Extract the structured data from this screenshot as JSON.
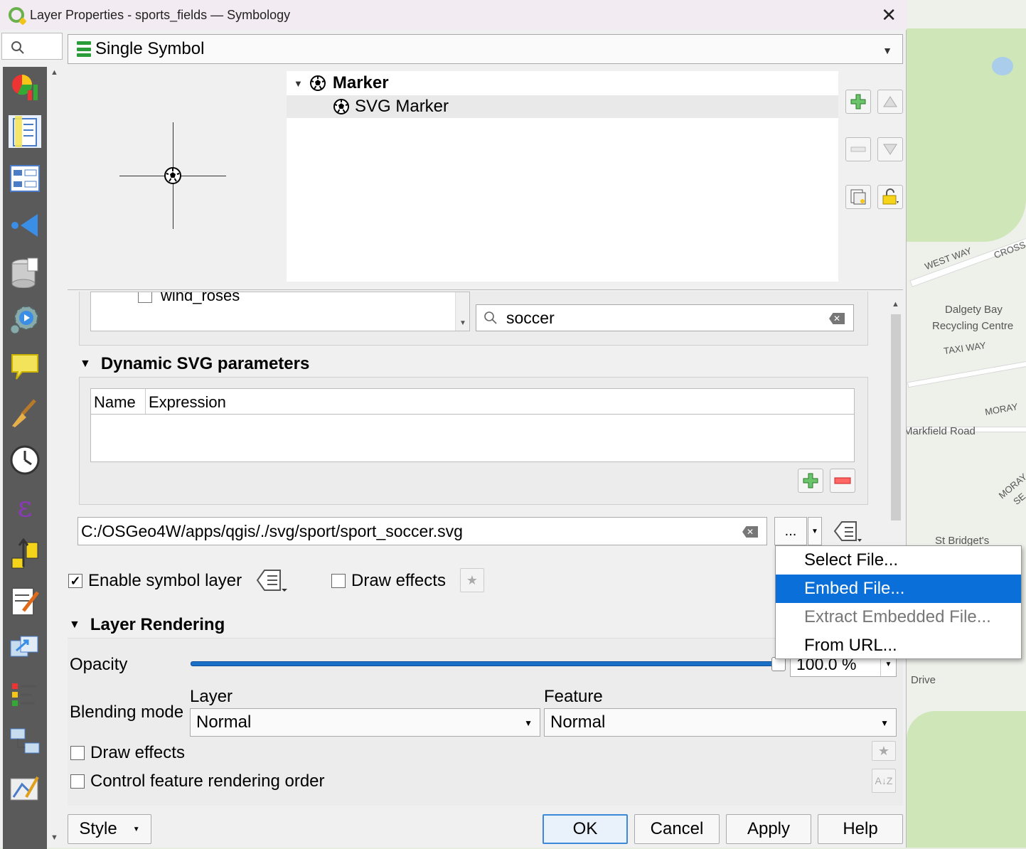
{
  "window": {
    "title": "Layer Properties - sports_fields — Symbology",
    "close_label": "✕"
  },
  "renderer": {
    "selected": "Single Symbol"
  },
  "symbol_tree": {
    "root": "Marker",
    "child": "SVG Marker"
  },
  "svg_browser": {
    "partial_item": "wind_roses",
    "search_value": "soccer"
  },
  "dynamic_svg": {
    "heading": "Dynamic SVG parameters",
    "columns": [
      "Name",
      "Expression"
    ]
  },
  "svg_path": {
    "value": "C:/OSGeo4W/apps/qgis/./svg/sport/sport_soccer.svg",
    "browse_label": "..."
  },
  "symbol_layer": {
    "enable_label": "Enable symbol layer",
    "enable_checked": true,
    "draw_effects_label": "Draw effects",
    "draw_effects_checked": false
  },
  "layer_rendering": {
    "heading": "Layer Rendering",
    "opacity_label": "Opacity",
    "opacity_value": "100.0 %",
    "opacity_fraction": 1.0,
    "blending_label": "Blending mode",
    "layer_label": "Layer",
    "layer_value": "Normal",
    "feature_label": "Feature",
    "feature_value": "Normal",
    "draw_effects_label": "Draw effects",
    "order_label": "Control feature rendering order"
  },
  "popup_menu": {
    "items": [
      {
        "label": "Select File...",
        "state": "normal"
      },
      {
        "label": "Embed File...",
        "state": "highlighted"
      },
      {
        "label": "Extract Embedded File...",
        "state": "disabled"
      },
      {
        "label": "From URL...",
        "state": "normal"
      }
    ]
  },
  "buttons": {
    "style": "Style",
    "ok": "OK",
    "cancel": "Cancel",
    "apply": "Apply",
    "help": "Help"
  },
  "map_labels": {
    "west_way": "WEST WAY",
    "cross": "CROSS",
    "dalgety": "Dalgety Bay",
    "recycling": "Recycling Centre",
    "taxi_way": "TAXI WAY",
    "moray1": "MORAY",
    "markfield": "Markfield Road",
    "moray2": "MORAY",
    "se": "SE",
    "st_bridgets": "St Bridget's",
    "drive": "Drive"
  },
  "colors": {
    "accent": "#0a6fd8",
    "slider": "#1a6fc7",
    "renderer_icon": "#2a9d3a"
  }
}
